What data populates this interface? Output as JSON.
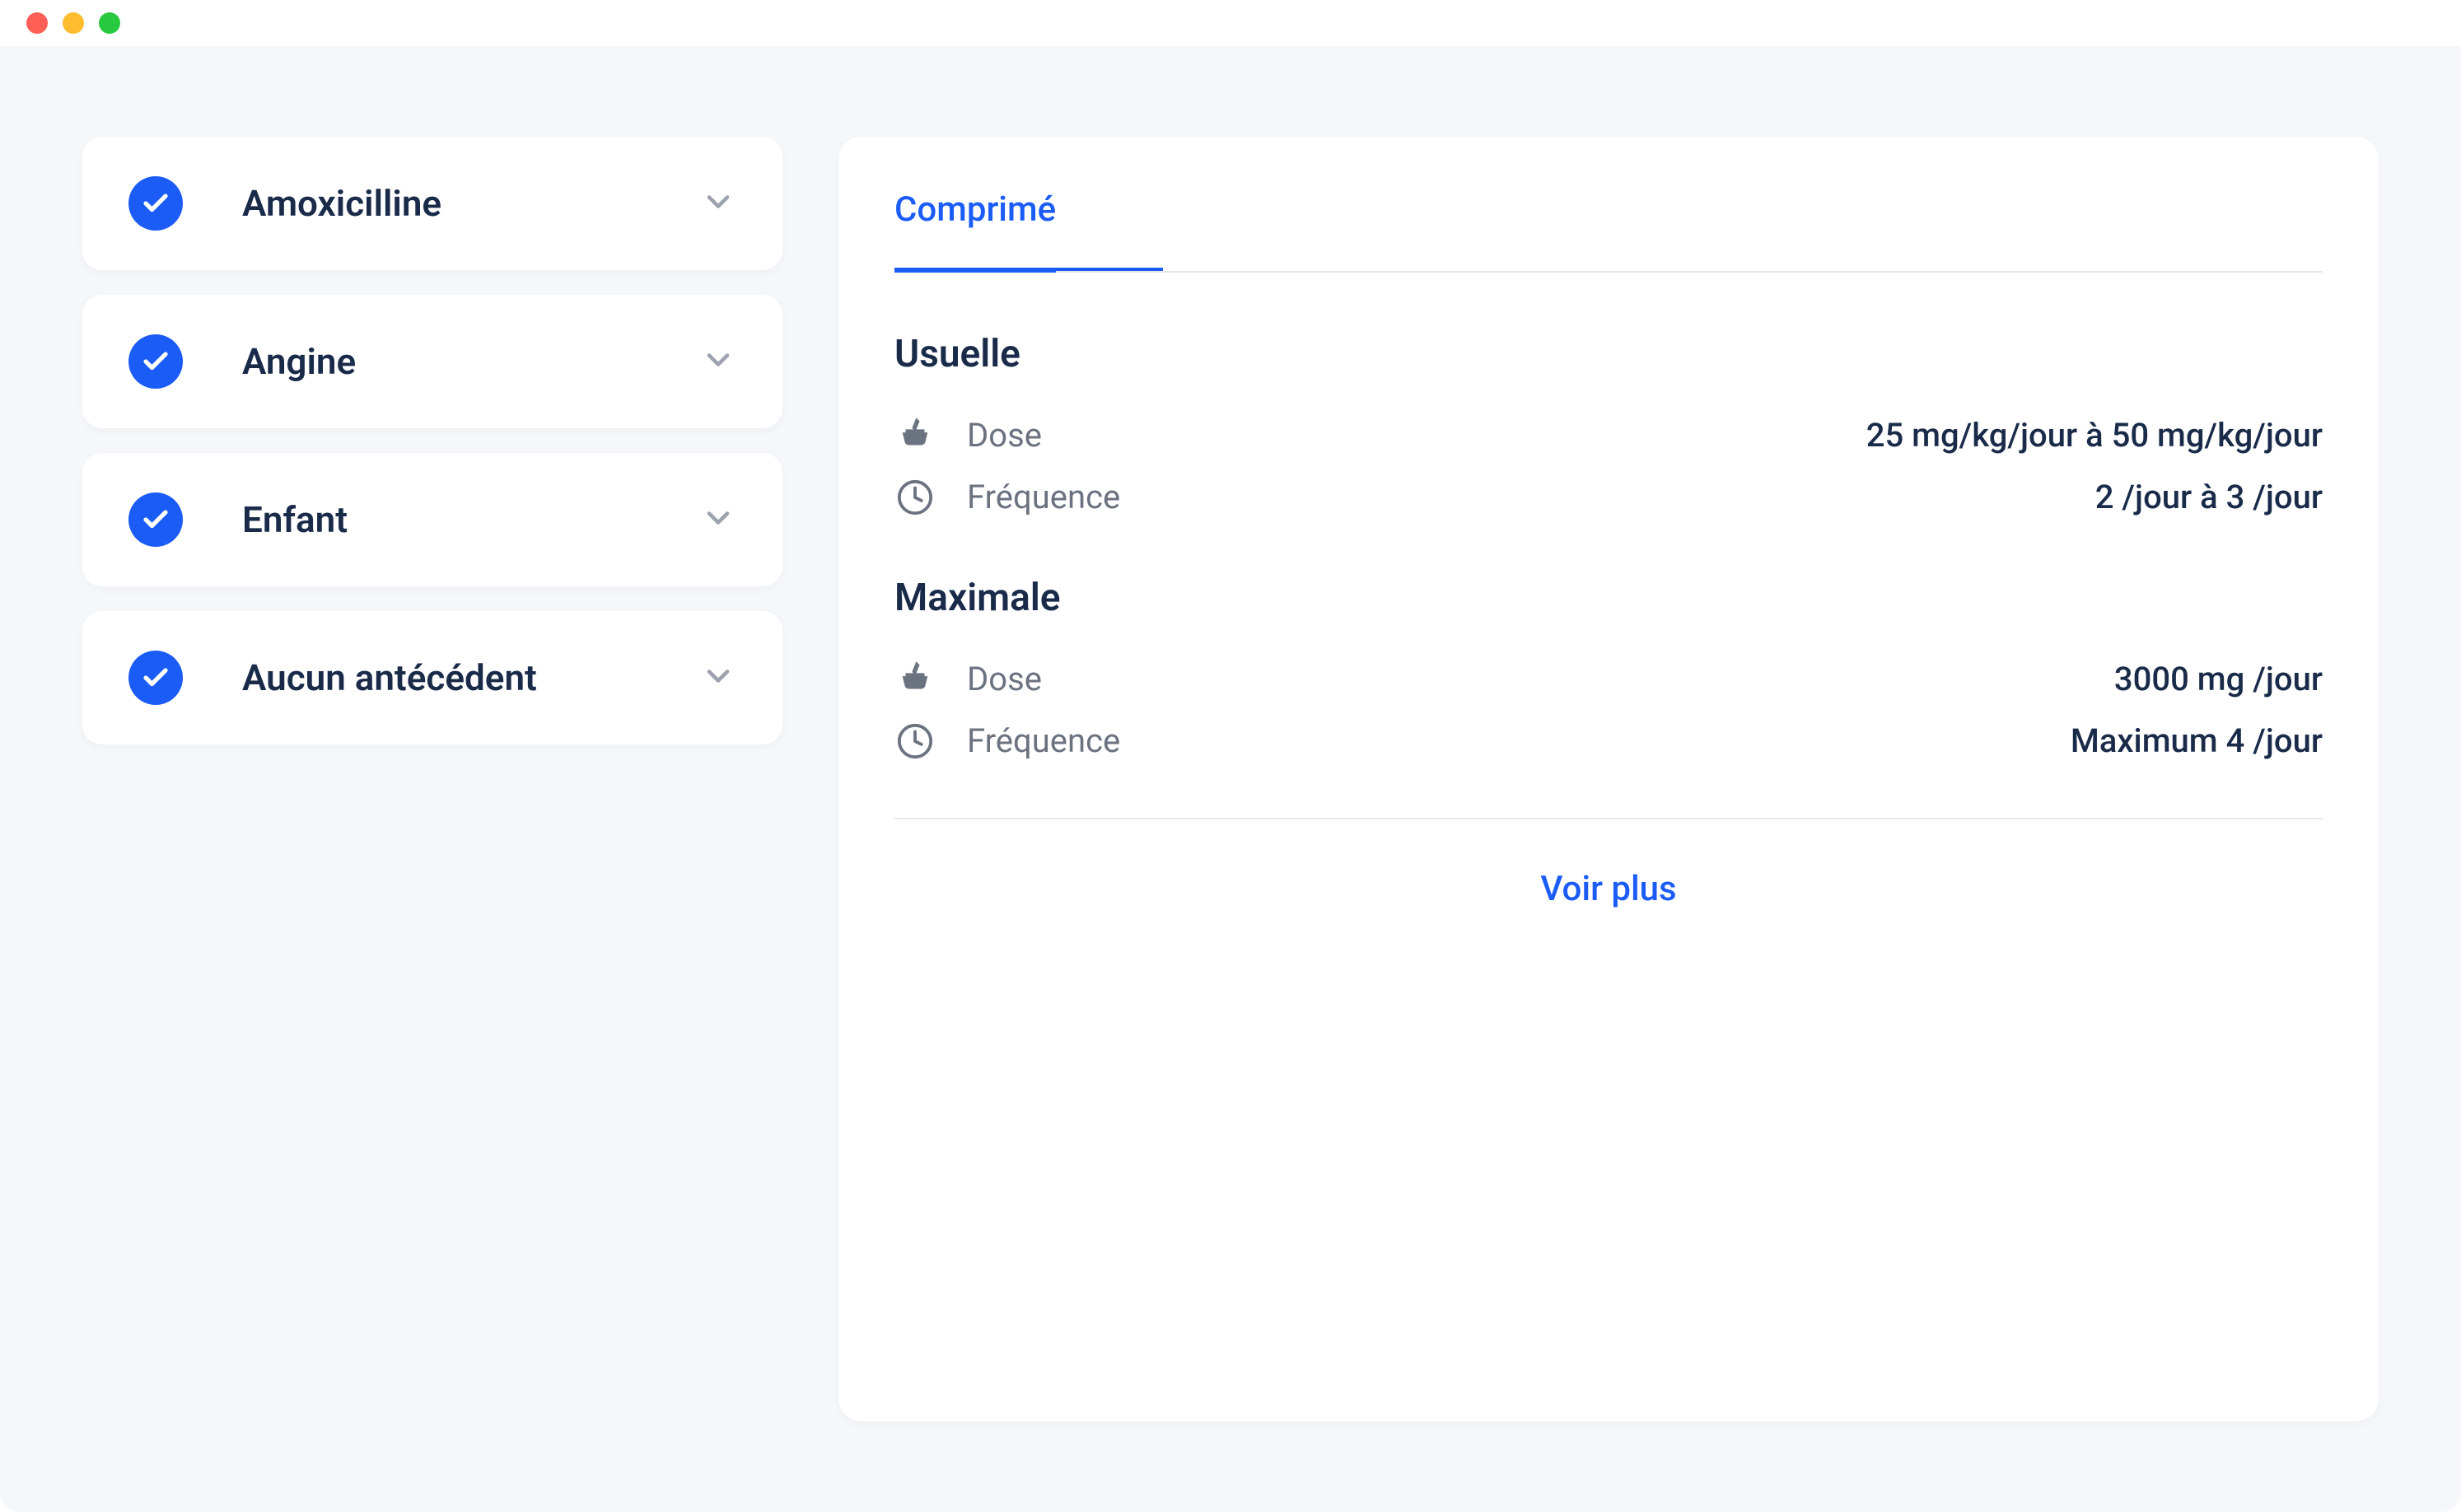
{
  "sidebar": {
    "filters": [
      {
        "label": "Amoxicilline"
      },
      {
        "label": "Angine"
      },
      {
        "label": "Enfant"
      },
      {
        "label": "Aucun antécédent"
      }
    ]
  },
  "tabs": {
    "active": "Comprimé"
  },
  "sections": {
    "usual": {
      "title": "Usuelle",
      "dose_label": "Dose",
      "dose_value": "25 mg/kg/jour à 50 mg/kg/jour",
      "freq_label": "Fréquence",
      "freq_value": "2 /jour à 3 /jour"
    },
    "maximum": {
      "title": "Maximale",
      "dose_label": "Dose",
      "dose_value": "3000 mg /jour",
      "freq_label": "Fréquence",
      "freq_value": "Maximum 4 /jour"
    }
  },
  "see_more": "Voir plus"
}
